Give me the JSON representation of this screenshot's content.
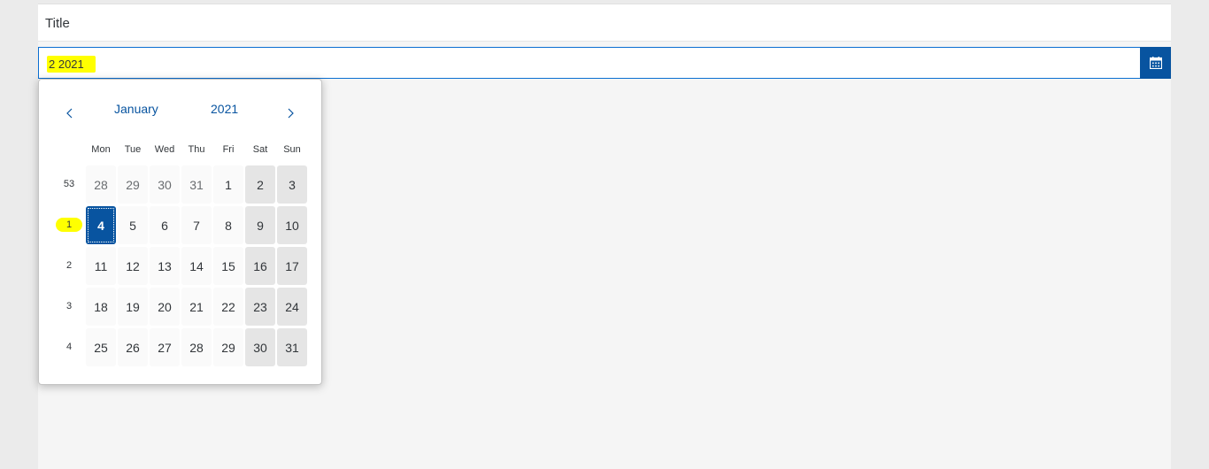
{
  "title": "Title",
  "date_input": {
    "value": "2 2021"
  },
  "calendar": {
    "month": "January",
    "year": "2021",
    "day_names": [
      "Mon",
      "Tue",
      "Wed",
      "Thu",
      "Fri",
      "Sat",
      "Sun"
    ],
    "weeks": [
      {
        "number": "53",
        "days": [
          "28",
          "29",
          "30",
          "31",
          "1",
          "2",
          "3"
        ]
      },
      {
        "number": "1",
        "days": [
          "4",
          "5",
          "6",
          "7",
          "8",
          "9",
          "10"
        ]
      },
      {
        "number": "2",
        "days": [
          "11",
          "12",
          "13",
          "14",
          "15",
          "16",
          "17"
        ]
      },
      {
        "number": "3",
        "days": [
          "18",
          "19",
          "20",
          "21",
          "22",
          "23",
          "24"
        ]
      },
      {
        "number": "4",
        "days": [
          "25",
          "26",
          "27",
          "28",
          "29",
          "30",
          "31"
        ]
      }
    ],
    "selected_day": "4",
    "highlighted_week": "1"
  },
  "icons": {
    "calendar_button": "calendar-icon",
    "prev": "chevron-left-icon",
    "next": "chevron-right-icon"
  },
  "colors": {
    "accent": "#0854a0",
    "highlight": "#ffff00",
    "weekend": "#e5e5e5"
  }
}
